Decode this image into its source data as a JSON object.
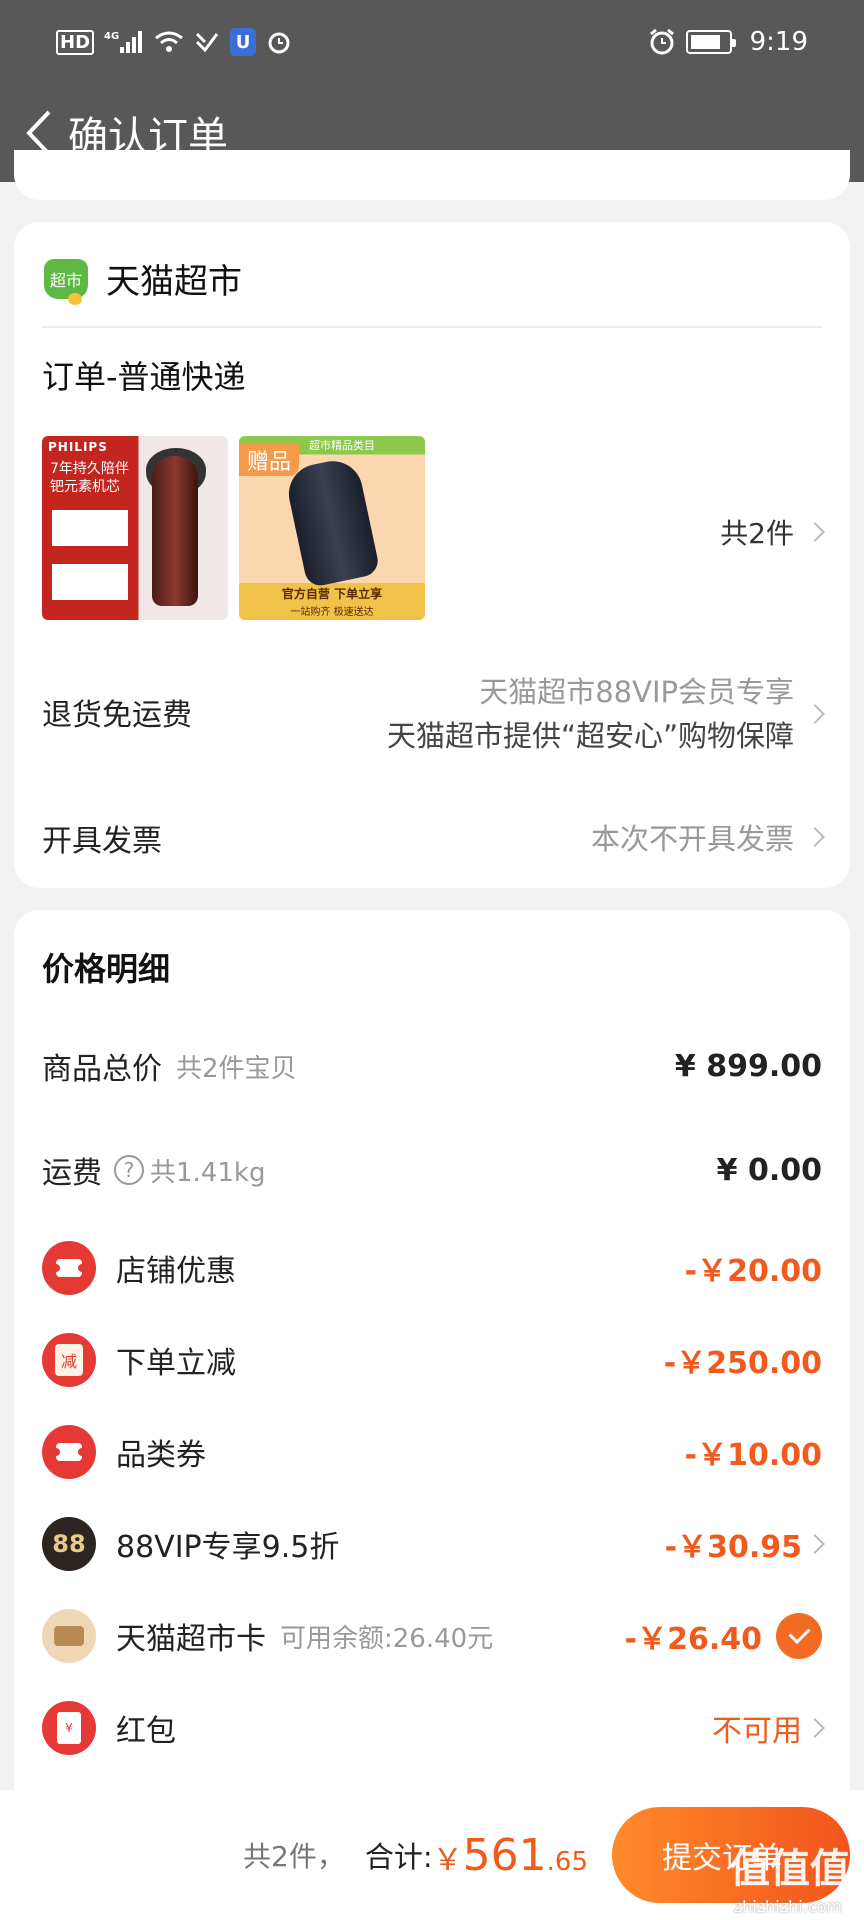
{
  "status_bar": {
    "left_icons": [
      "HD",
      "4G",
      "signal",
      "wifi",
      "nfc",
      "shield",
      "alarm"
    ],
    "time": "9:19"
  },
  "nav": {
    "title": "确认订单"
  },
  "store": {
    "name": "天猫超市",
    "logo_text": "超市",
    "shipping_label": "订单-普通快递",
    "items": [
      {
        "brand": "PHILIPS",
        "promo": "7年持久陪伴 钯元素机芯"
      },
      {
        "tag": "赠品",
        "top": "超市精品类目",
        "bottom": "官方自营 下单立享",
        "bottom2": "一站购齐 极速送达"
      }
    ],
    "item_count": "共2件",
    "return_label": "退货免运费",
    "return_line1": "天猫超市88VIP会员专享",
    "return_line2": "天猫超市提供“超安心”购物保障",
    "invoice_label": "开具发票",
    "invoice_value": "本次不开具发票"
  },
  "price": {
    "title": "价格明细",
    "goods_label": "商品总价",
    "goods_sub": "共2件宝贝",
    "goods_amount": "¥ 899.00",
    "shipping_label": "运费",
    "shipping_sub": "共1.41kg",
    "shipping_amount": "¥ 0.00",
    "discounts": [
      {
        "label": "店铺优惠",
        "amount": "-￥20.00"
      },
      {
        "label": "下单立减",
        "amount": "-￥250.00",
        "icon_text": "减"
      },
      {
        "label": "品类券",
        "amount": "-￥10.00"
      },
      {
        "label": "88VIP专享9.5折",
        "amount": "-￥30.95",
        "icon_text": "88"
      },
      {
        "label": "天猫超市卡",
        "sub": "可用余额:26.40元",
        "amount": "-￥26.40"
      },
      {
        "label": "红包",
        "amount": "不可用",
        "icon_text": "¥"
      }
    ]
  },
  "footer": {
    "count": "共2件，",
    "total_label": "合计:",
    "currency": "￥",
    "total_int": "561",
    "total_dec": ".65",
    "submit": "提交订单",
    "watermark": "值值值",
    "watermark_sub": "zhizhizhi.com"
  },
  "colors": {
    "accent": "#f05b1d",
    "header_bg": "#585858"
  }
}
